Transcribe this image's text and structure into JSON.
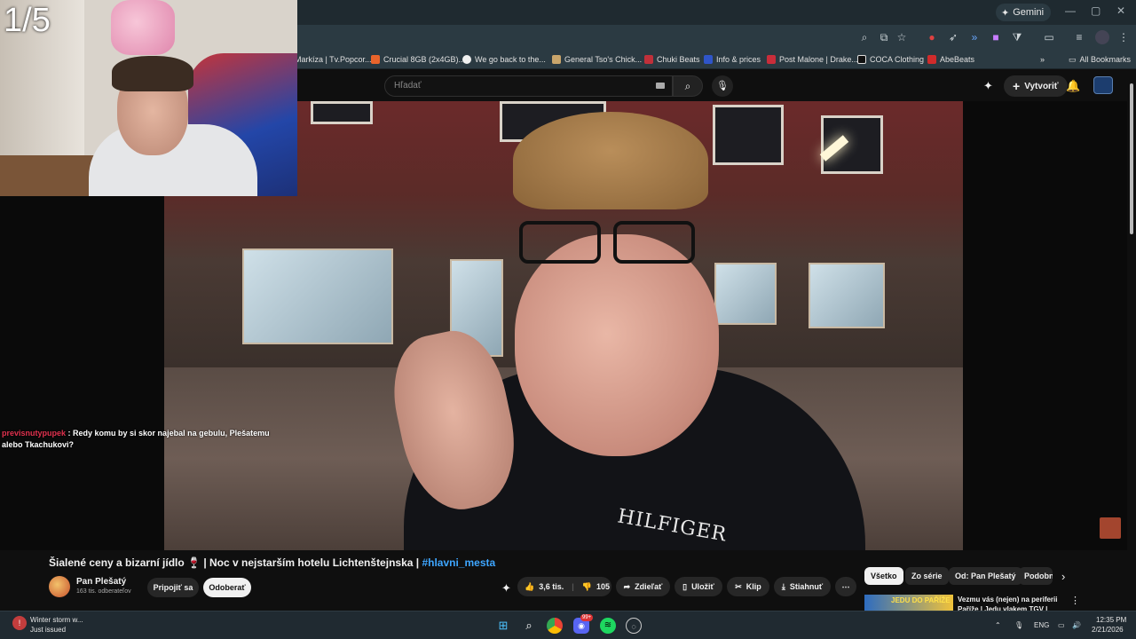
{
  "overlay": {
    "counter": "1/5",
    "chat": {
      "user": "previsnutypupek",
      "message": " : Redy komu by si skor najebal na gebulu, Plešatemu alebo Tkachukovi?"
    }
  },
  "browser": {
    "gemini_label": "Gemini",
    "bookmarks": [
      "Markíza | Tv.Popcor...",
      "Crucial 8GB (2x4GB)...",
      "We go back to the...",
      "General Tso's Chick...",
      "Chuki Beats",
      "Info & prices",
      "Post Malone | Drake...",
      "COCA Clothing",
      "AbeBeats"
    ],
    "all_bookmarks": "All Bookmarks"
  },
  "youtube": {
    "search_placeholder": "Hľadať",
    "create_label": "Vytvoriť",
    "video": {
      "brand_text": "HILFIGER"
    },
    "title_main": "Šialené ceny a bizarní jídlo 🍷 | Noc v nejstarším hotelu Lichtenštejnska | ",
    "title_hashtag": "#hlavni_mesta",
    "channel": {
      "name": "Pan Plešatý",
      "subs": "163 tis. odberateľov"
    },
    "join_label": "Pripojiť sa",
    "subscribe_label": "Odoberať",
    "likes": "3,6 tis.",
    "dislikes": "105",
    "share_label": "Zdieľať",
    "save_label": "Uložiť",
    "clip_label": "Klip",
    "download_label": "Stiahnuť",
    "chips": [
      "Všetko",
      "Zo série",
      "Od: Pan Plešatý",
      "Podobné"
    ],
    "rec": {
      "thumb_text": "JEDU DO PAŘÍŽE",
      "title": "Vezmu vás (nejen) na periferii Paříže | Jedu vlakem TGV |"
    }
  },
  "taskbar": {
    "weather_line1": "Winter storm w...",
    "weather_line2": "Just issued",
    "lang": "ENG",
    "time": "12:35 PM",
    "date": "2/21/2026",
    "badge": "99+"
  }
}
